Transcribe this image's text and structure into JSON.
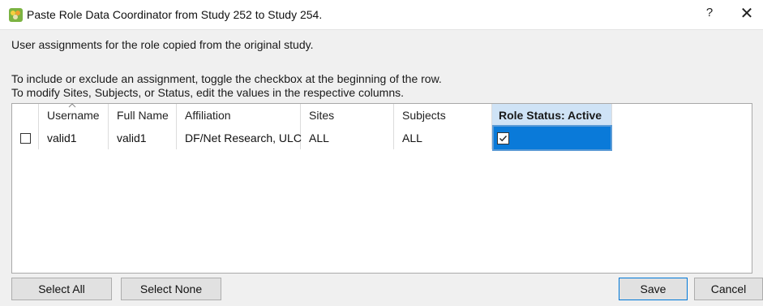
{
  "window": {
    "title": "Paste Role Data Coordinator from Study 252 to Study  254.",
    "help_label": "?",
    "close_label": "✕"
  },
  "description": {
    "line1": "User assignments for the role copied from the original study.",
    "line2": "To include or exclude an assignment, toggle the checkbox at the beginning of the row.",
    "line3": "To modify Sites, Subjects, or Status, edit the values in the respective columns."
  },
  "table": {
    "columns": {
      "username": "Username",
      "full_name": "Full Name",
      "affiliation": "Affiliation",
      "sites": "Sites",
      "subjects": "Subjects",
      "role_status": "Role Status: Active"
    },
    "rows": [
      {
        "included": false,
        "username": "valid1",
        "full_name": "valid1",
        "affiliation": "DF/Net Research, ULC",
        "sites": "ALL",
        "subjects": "ALL",
        "role_active": true
      }
    ]
  },
  "buttons": {
    "select_all": "Select All",
    "select_none": "Select None",
    "save": "Save",
    "cancel": "Cancel"
  },
  "colors": {
    "selected_cell": "#0a7ad9",
    "header_highlight": "#cfe3f6",
    "app_icon": "#7cb342"
  },
  "icons": {
    "app": "app-logo-icon",
    "sort": "sort-caret-icon",
    "check": "checkmark-icon"
  }
}
